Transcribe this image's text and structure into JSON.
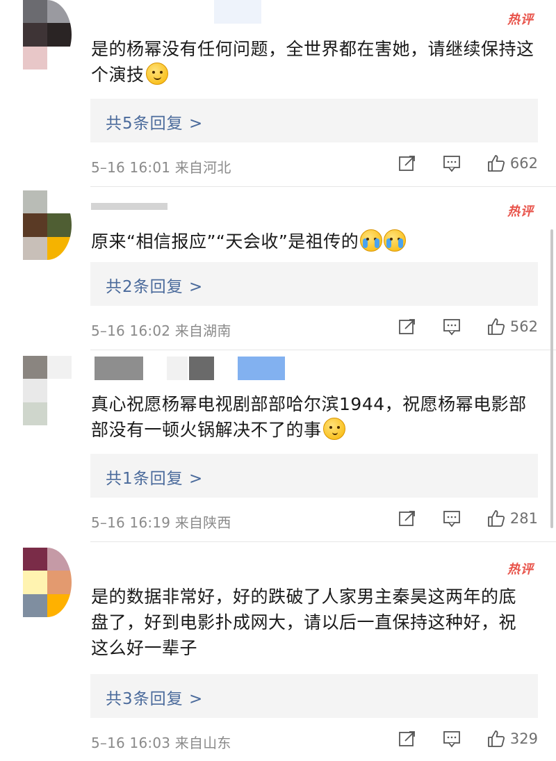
{
  "hot_label": "热评",
  "comments": [
    {
      "text": "是的杨幂没有任何问题，全世界都在害她，请继续保持这个演技",
      "reply": "共5条回复 >",
      "meta": "5–16 16:01  来自河北",
      "likes": "662",
      "emoji": "smile",
      "avatar": [
        "#6b6b70",
        "#9a9aa0",
        "#3e3436",
        "#2a2424",
        "#e8c7c8",
        "#ffffff"
      ]
    },
    {
      "text": "原来“相信报应”“天会收”是祖传的",
      "reply": "共2条回复 >",
      "meta": "5–16 16:02  来自湖南",
      "likes": "562",
      "emoji": "cry",
      "avatar": [
        "#b9bcb6",
        "#ffffff",
        "#5a3a25",
        "#4f5e33",
        "#c8bfb8",
        "#f5b300"
      ]
    },
    {
      "text": "真心祝愿杨幂电视剧部部哈尔滨1944，祝愿杨幂电影部部没有一顿火锅解决不了的事",
      "reply": "共1条回复 >",
      "meta": "5–16 16:19  来自陕西",
      "likes": "281",
      "emoji": "think",
      "avatar": [
        "#8a8580",
        "#f1f1f1",
        "#e9e9e9",
        "#ffffff",
        "#cfd6cc",
        "#ffffff"
      ]
    },
    {
      "text": "是的数据非常好，好的跌破了人家男主秦昊这两年的底盘了，好到电影扑成网大，请以后一直保持这种好，祝这么好一辈子",
      "reply": "共3条回复 >",
      "meta": "5–16 16:03  来自山东",
      "likes": "329",
      "emoji": "",
      "avatar": [
        "#7a2c48",
        "#c59aa6",
        "#fff3b0",
        "#e39a6f",
        "#7f8ea0",
        "#ffb100"
      ]
    }
  ]
}
